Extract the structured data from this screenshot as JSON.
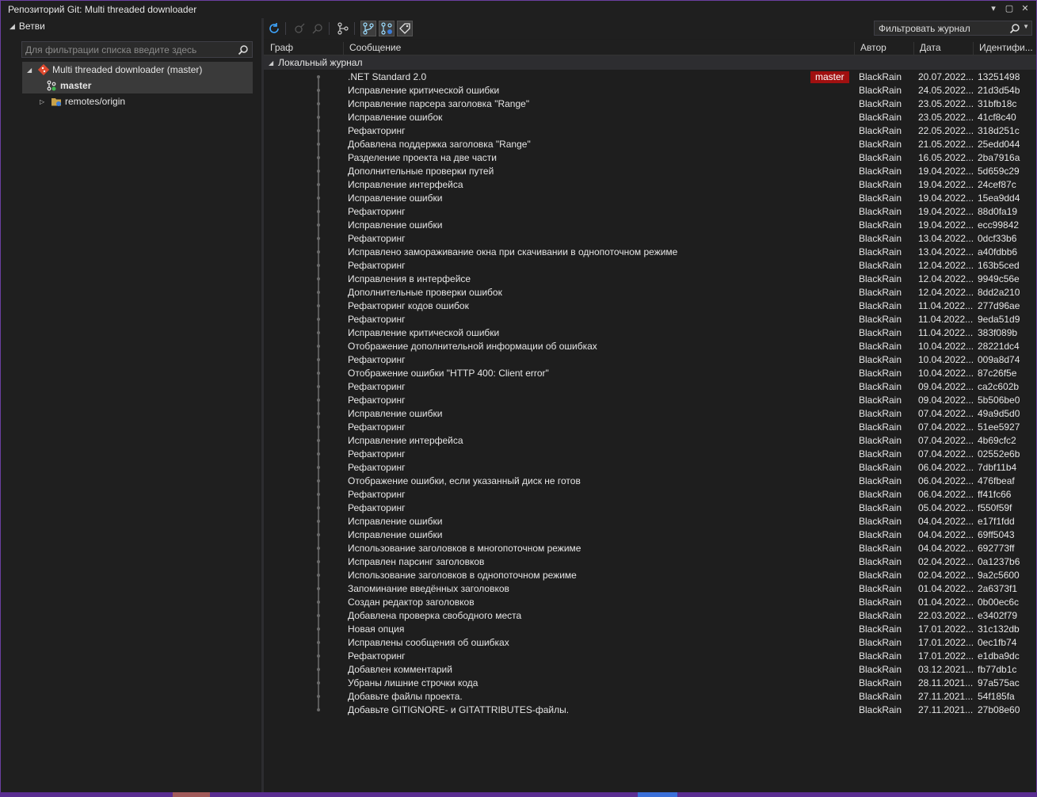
{
  "window": {
    "title": "Репозиторий Git: Multi threaded downloader"
  },
  "branches": {
    "header": "Ветви",
    "filter_placeholder": "Для фильтрации списка введите здесь",
    "repo": "Multi threaded downloader (master)",
    "current_branch": "master",
    "remotes": "remotes/origin"
  },
  "toolbar": {
    "log_filter": "Фильтровать журнал"
  },
  "columns": {
    "graph": "Граф",
    "message": "Сообщение",
    "author": "Автор",
    "date": "Дата",
    "id": "Идентифи..."
  },
  "group": {
    "label": "Локальный журнал"
  },
  "branch_badge": "master",
  "commits": [
    {
      "msg": ".NET Standard 2.0",
      "author": "BlackRain",
      "date": "20.07.2022...",
      "id": "13251498"
    },
    {
      "msg": "Исправление критической ошибки",
      "author": "BlackRain",
      "date": "24.05.2022...",
      "id": "21d3d54b"
    },
    {
      "msg": "Исправление парсера заголовка \"Range\"",
      "author": "BlackRain",
      "date": "23.05.2022...",
      "id": "31bfb18c"
    },
    {
      "msg": "Исправление ошибок",
      "author": "BlackRain",
      "date": "23.05.2022...",
      "id": "41cf8c40"
    },
    {
      "msg": "Рефакторинг",
      "author": "BlackRain",
      "date": "22.05.2022...",
      "id": "318d251c"
    },
    {
      "msg": "Добавлена поддержка заголовка \"Range\"",
      "author": "BlackRain",
      "date": "21.05.2022...",
      "id": "25edd044"
    },
    {
      "msg": "Разделение проекта на две части",
      "author": "BlackRain",
      "date": "16.05.2022...",
      "id": "2ba7916a"
    },
    {
      "msg": "Дополнительные проверки путей",
      "author": "BlackRain",
      "date": "19.04.2022...",
      "id": "5d659c29"
    },
    {
      "msg": "Исправление интерфейса",
      "author": "BlackRain",
      "date": "19.04.2022...",
      "id": "24cef87c"
    },
    {
      "msg": "Исправление ошибки",
      "author": "BlackRain",
      "date": "19.04.2022...",
      "id": "15ea9dd4"
    },
    {
      "msg": "Рефакторинг",
      "author": "BlackRain",
      "date": "19.04.2022...",
      "id": "88d0fa19"
    },
    {
      "msg": "Исправление ошибки",
      "author": "BlackRain",
      "date": "19.04.2022...",
      "id": "ecc99842"
    },
    {
      "msg": "Рефакторинг",
      "author": "BlackRain",
      "date": "13.04.2022...",
      "id": "0dcf33b6"
    },
    {
      "msg": "Исправлено замораживание окна при скачивании в однопоточном режиме",
      "author": "BlackRain",
      "date": "13.04.2022...",
      "id": "a40fdbb6"
    },
    {
      "msg": "Рефакторинг",
      "author": "BlackRain",
      "date": "12.04.2022...",
      "id": "163b5ced"
    },
    {
      "msg": "Исправления в интерфейсе",
      "author": "BlackRain",
      "date": "12.04.2022...",
      "id": "9949c56e"
    },
    {
      "msg": "Дополнительные проверки ошибок",
      "author": "BlackRain",
      "date": "12.04.2022...",
      "id": "8dd2a210"
    },
    {
      "msg": "Рефакторинг кодов ошибок",
      "author": "BlackRain",
      "date": "11.04.2022...",
      "id": "277d96ae"
    },
    {
      "msg": "Рефакторинг",
      "author": "BlackRain",
      "date": "11.04.2022...",
      "id": "9eda51d9"
    },
    {
      "msg": "Исправление критической ошибки",
      "author": "BlackRain",
      "date": "11.04.2022...",
      "id": "383f089b"
    },
    {
      "msg": "Отображение дополнительной информации об ошибках",
      "author": "BlackRain",
      "date": "10.04.2022...",
      "id": "28221dc4"
    },
    {
      "msg": "Рефакторинг",
      "author": "BlackRain",
      "date": "10.04.2022...",
      "id": "009a8d74"
    },
    {
      "msg": "Отображение ошибки \"HTTP 400: Client error\"",
      "author": "BlackRain",
      "date": "10.04.2022...",
      "id": "87c26f5e"
    },
    {
      "msg": "Рефакторинг",
      "author": "BlackRain",
      "date": "09.04.2022...",
      "id": "ca2c602b"
    },
    {
      "msg": "Рефакторинг",
      "author": "BlackRain",
      "date": "09.04.2022...",
      "id": "5b506be0"
    },
    {
      "msg": "Исправление ошибки",
      "author": "BlackRain",
      "date": "07.04.2022...",
      "id": "49a9d5d0"
    },
    {
      "msg": "Рефакторинг",
      "author": "BlackRain",
      "date": "07.04.2022...",
      "id": "51ee5927"
    },
    {
      "msg": "Исправление интерфейса",
      "author": "BlackRain",
      "date": "07.04.2022...",
      "id": "4b69cfc2"
    },
    {
      "msg": "Рефакторинг",
      "author": "BlackRain",
      "date": "07.04.2022...",
      "id": "02552e6b"
    },
    {
      "msg": "Рефакторинг",
      "author": "BlackRain",
      "date": "06.04.2022...",
      "id": "7dbf11b4"
    },
    {
      "msg": "Отображение ошибки, если указанный диск не готов",
      "author": "BlackRain",
      "date": "06.04.2022...",
      "id": "476fbeaf"
    },
    {
      "msg": "Рефакторинг",
      "author": "BlackRain",
      "date": "06.04.2022...",
      "id": "ff41fc66"
    },
    {
      "msg": "Рефакторинг",
      "author": "BlackRain",
      "date": "05.04.2022...",
      "id": "f550f59f"
    },
    {
      "msg": "Исправление ошибки",
      "author": "BlackRain",
      "date": "04.04.2022...",
      "id": "e17f1fdd"
    },
    {
      "msg": "Исправление ошибки",
      "author": "BlackRain",
      "date": "04.04.2022...",
      "id": "69ff5043"
    },
    {
      "msg": "Использование заголовков в многопоточном режиме",
      "author": "BlackRain",
      "date": "04.04.2022...",
      "id": "692773ff"
    },
    {
      "msg": "Исправлен парсинг заголовков",
      "author": "BlackRain",
      "date": "02.04.2022...",
      "id": "0a1237b6"
    },
    {
      "msg": "Использование заголовков в однопоточном режиме",
      "author": "BlackRain",
      "date": "02.04.2022...",
      "id": "9a2c5600"
    },
    {
      "msg": "Запоминание введённых заголовков",
      "author": "BlackRain",
      "date": "01.04.2022...",
      "id": "2a6373f1"
    },
    {
      "msg": "Создан редактор заголовков",
      "author": "BlackRain",
      "date": "01.04.2022...",
      "id": "0b00ec6c"
    },
    {
      "msg": "Добавлена проверка свободного места",
      "author": "BlackRain",
      "date": "22.03.2022...",
      "id": "e3402f79"
    },
    {
      "msg": "Новая опция",
      "author": "BlackRain",
      "date": "17.01.2022...",
      "id": "31c132db"
    },
    {
      "msg": "Исправлены сообщения об ошибках",
      "author": "BlackRain",
      "date": "17.01.2022...",
      "id": "0ec1fb74"
    },
    {
      "msg": "Рефакторинг",
      "author": "BlackRain",
      "date": "17.01.2022...",
      "id": "e1dba9dc"
    },
    {
      "msg": "Добавлен комментарий",
      "author": "BlackRain",
      "date": "03.12.2021...",
      "id": "fb77db1c"
    },
    {
      "msg": "Убраны лишние строчки кода",
      "author": "BlackRain",
      "date": "28.11.2021...",
      "id": "97a575ac"
    },
    {
      "msg": "Добавьте файлы проекта.",
      "author": "BlackRain",
      "date": "27.11.2021...",
      "id": "54f185fa"
    },
    {
      "msg": "Добавьте GITIGNORE- и GITATTRIBUTES-файлы.",
      "author": "BlackRain",
      "date": "27.11.2021...",
      "id": "27b08e60"
    }
  ]
}
